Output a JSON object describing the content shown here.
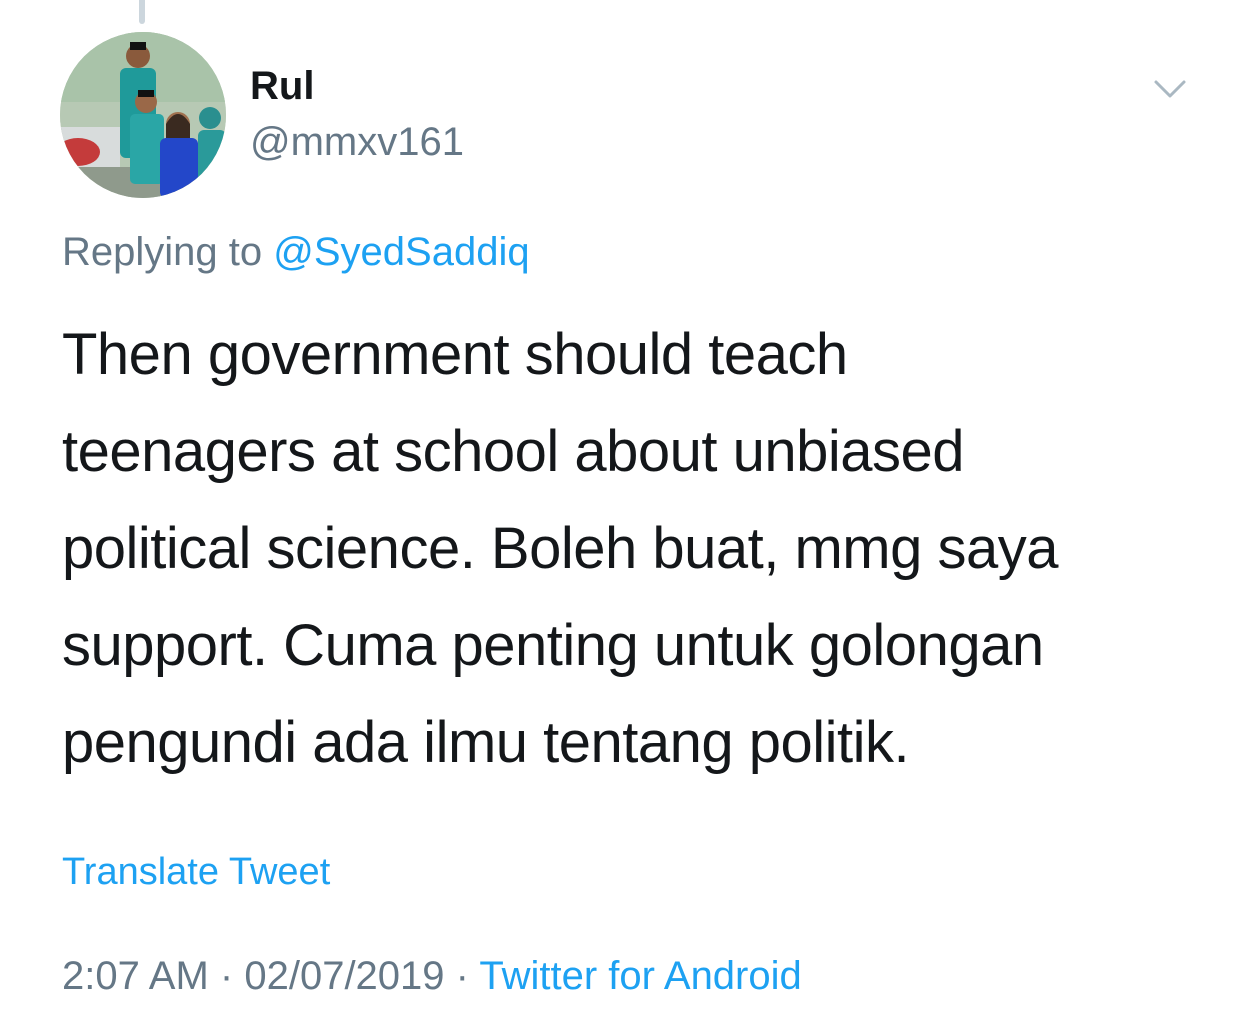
{
  "tweet": {
    "author": {
      "display_name": "Rul",
      "handle": "@mmxv161",
      "avatar_icon": "profile-photo-family"
    },
    "menu_icon": "chevron-down-icon",
    "replying_to": {
      "prefix": "Replying to",
      "mention": "@SyedSaddiq"
    },
    "text_lines": [
      "Then government should teach",
      "teenagers at school about unbiased",
      "political science. Boleh buat, mmg saya",
      "support. Cuma penting untuk golongan",
      "pengundi ada ilmu tentang politik."
    ],
    "translate_label": "Translate Tweet",
    "timestamp": {
      "time": "2:07 AM",
      "separator": "·",
      "date": "02/07/2019",
      "source": "Twitter for Android"
    }
  },
  "colors": {
    "text_primary": "#14171a",
    "text_secondary": "#657786",
    "link_blue": "#1da1f2",
    "thread_line": "#ccd6dd"
  }
}
